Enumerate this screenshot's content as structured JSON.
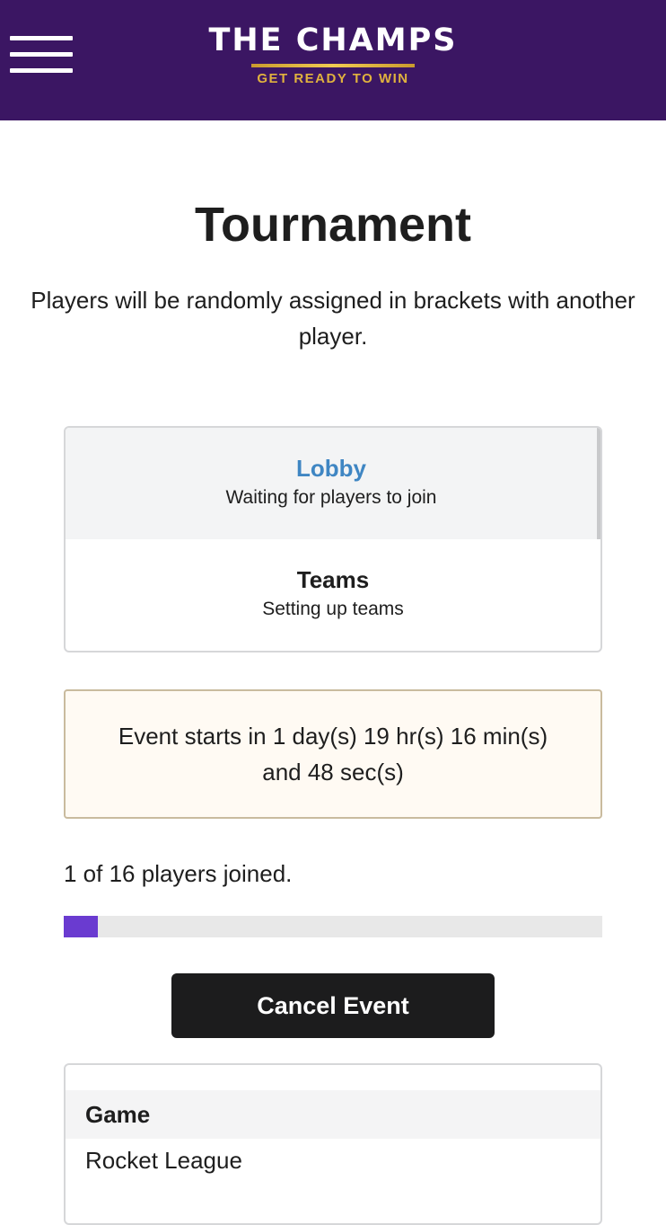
{
  "header": {
    "menu_icon": "hamburger-menu-icon",
    "logo_title": "THE CHAMPS",
    "logo_tagline": "GET READY TO WIN",
    "background_color": "#3b1663"
  },
  "page": {
    "title": "Tournament",
    "description": "Players will be randomly assigned in brackets with another player."
  },
  "stages": [
    {
      "label": "Lobby",
      "description": "Waiting for players to join",
      "active": true
    },
    {
      "label": "Teams",
      "description": "Setting up teams",
      "active": false
    }
  ],
  "countdown": {
    "text": "Event starts in 1 day(s) 19 hr(s) 16 min(s) and 48 sec(s)"
  },
  "players": {
    "joined_text": "1 of 16 players joined.",
    "joined": 1,
    "total": 16,
    "progress_color": "#6a3bd0"
  },
  "actions": {
    "cancel_label": "Cancel Event"
  },
  "details": {
    "game_header": "Game",
    "game_value": "Rocket League"
  },
  "colors": {
    "accent_blue": "#3f86c3",
    "button_dark": "#1c1c1d",
    "countdown_bg": "#fffaf3"
  }
}
